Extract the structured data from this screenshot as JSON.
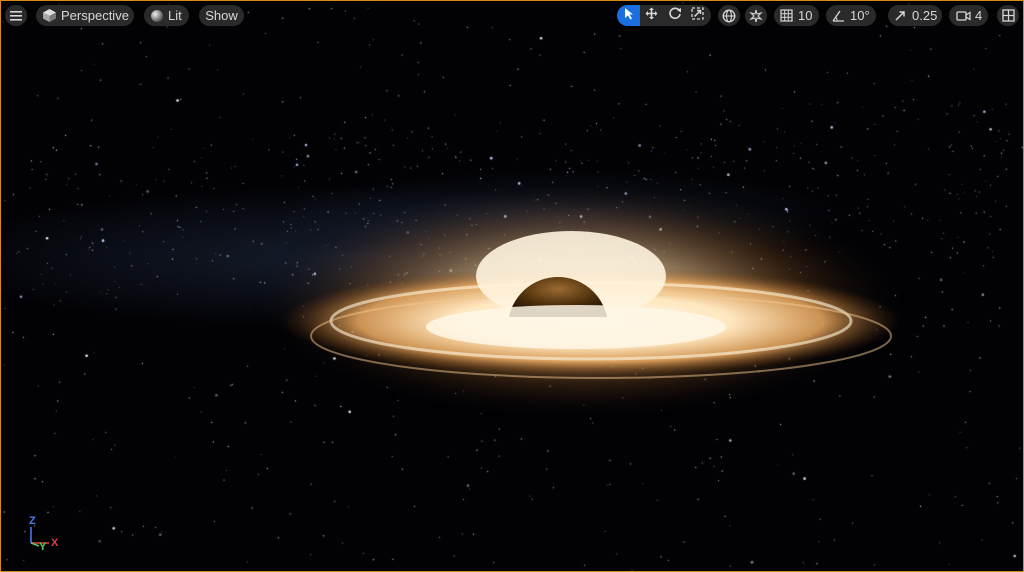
{
  "toolbar": {
    "view_mode": "Perspective",
    "lighting": "Lit",
    "show": "Show",
    "grid_snap": "10",
    "rotation_snap": "10°",
    "scale_snap": "0.25",
    "camera_speed": "4"
  },
  "gizmo": {
    "z": "Z",
    "y": "Y",
    "x": "X"
  },
  "colors": {
    "accent_border": "#d88a1a",
    "active_tool": "#1a6ee0",
    "pill_bg": "#2a2a2a",
    "text": "#d8d8d8",
    "axis_x": "#e04040",
    "axis_y": "#5ec85e",
    "axis_z": "#4a7ff0"
  },
  "icons": [
    "hamburger-menu-icon",
    "cube-icon",
    "sphere-icon",
    "select-arrow-icon",
    "translate-icon",
    "rotate-icon",
    "scale-icon",
    "globe-icon",
    "surface-snap-icon",
    "grid-icon",
    "angle-icon",
    "scale-snap-icon",
    "camera-icon",
    "layout-icon"
  ]
}
